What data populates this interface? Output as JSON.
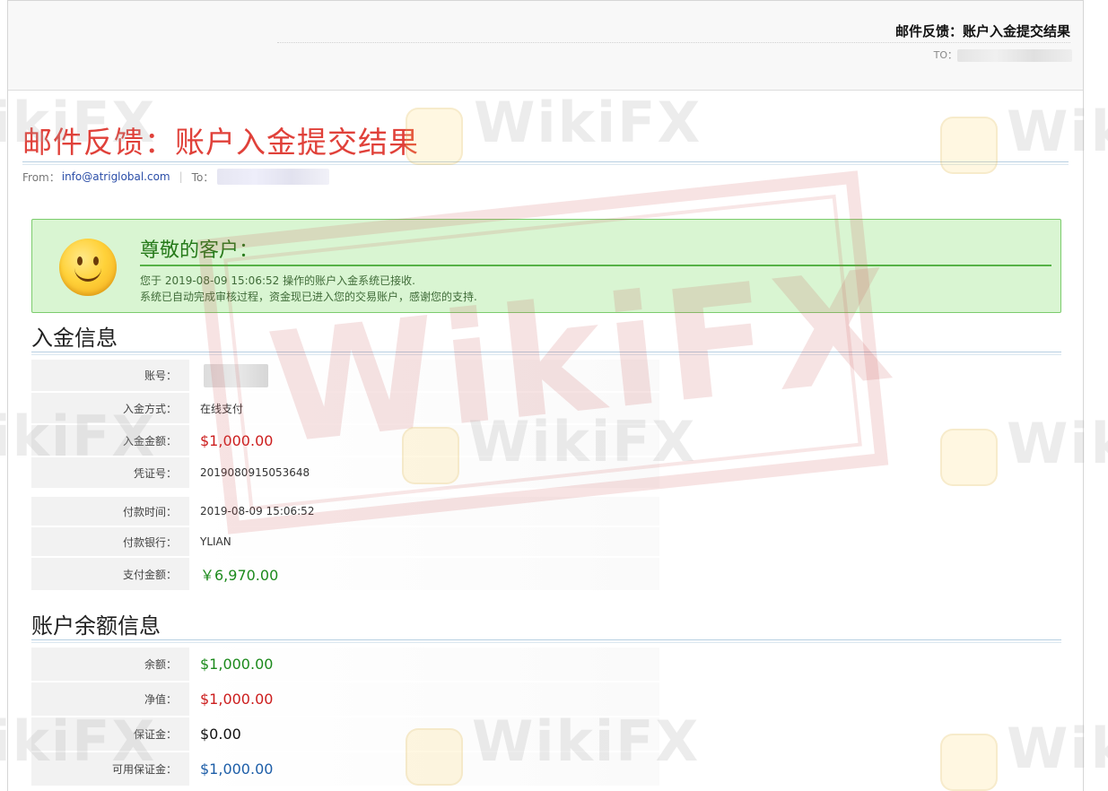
{
  "header": {
    "title": "邮件反馈：账户入金提交结果",
    "to_label": "TO："
  },
  "email": {
    "title": "邮件反馈：账户入金提交结果",
    "from_label": "From：",
    "from_address": "info@atriglobal.com",
    "separator": "|",
    "to_label": "To："
  },
  "notice": {
    "greeting": "尊敬的客户：",
    "line1": "您于 2019-08-09 15:06:52 操作的账户入金系统已接收.",
    "line2": "系统已自动完成审核过程，资金现已进入您的交易账户，感谢您的支持.",
    "icon": "smiley-face-icon"
  },
  "deposit_info": {
    "title": "入金信息",
    "rows": [
      {
        "label": "账号：",
        "value": ""
      },
      {
        "label": "入金方式：",
        "value": "在线支付"
      },
      {
        "label": "入金金额：",
        "value": "$1,000.00"
      },
      {
        "label": "凭证号：",
        "value": "2019080915053648"
      }
    ],
    "payment_rows": [
      {
        "label": "付款时间：",
        "value": "2019-08-09 15:06:52"
      },
      {
        "label": "付款银行：",
        "value": "YLIAN"
      },
      {
        "label": "支付金额：",
        "value": "￥6,970.00"
      }
    ]
  },
  "balance_info": {
    "title": "账户余额信息",
    "rows": [
      {
        "label": "余额：",
        "value": "$1,000.00"
      },
      {
        "label": "净值：",
        "value": "$1,000.00"
      },
      {
        "label": "保证金：",
        "value": "$0.00"
      },
      {
        "label": "可用保证金：",
        "value": "$1,000.00"
      }
    ]
  },
  "watermark": {
    "text": "WikiFX"
  },
  "colors": {
    "title_red": "#e0413a",
    "amount_red": "#cc1d1d",
    "amount_green": "#1c8a1c",
    "amount_blue": "#1d5ea8",
    "notice_bg": "#d9f5d2",
    "notice_border": "#7ccc6d"
  }
}
